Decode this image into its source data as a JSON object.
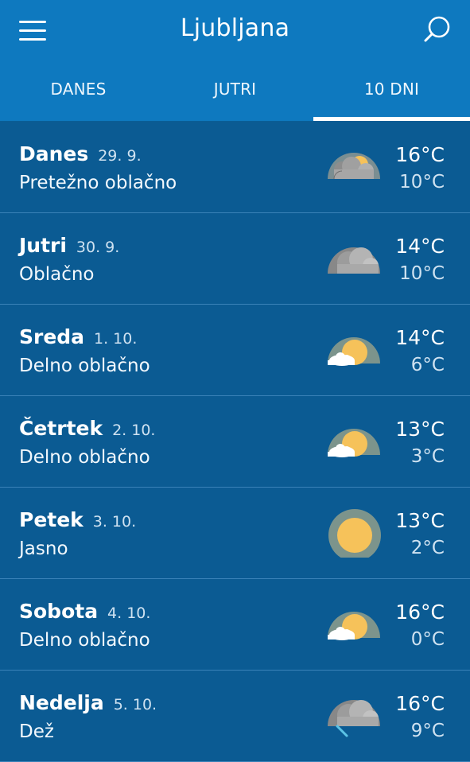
{
  "header": {
    "title": "Ljubljana",
    "menu_icon": "hamburger-menu-icon",
    "search_icon": "search-icon"
  },
  "tabs": [
    {
      "label": "DANES",
      "active": false
    },
    {
      "label": "JUTRI",
      "active": false
    },
    {
      "label": "10 DNI",
      "active": true
    }
  ],
  "days": [
    {
      "name": "Danes",
      "date": "29. 9.",
      "condition": "Pretežno oblačno",
      "high": "16°C",
      "low": "10°C",
      "icon": "mostly-cloudy-icon"
    },
    {
      "name": "Jutri",
      "date": "30. 9.",
      "condition": "Oblačno",
      "high": "14°C",
      "low": "10°C",
      "icon": "cloudy-icon"
    },
    {
      "name": "Sreda",
      "date": "1. 10.",
      "condition": "Delno oblačno",
      "high": "14°C",
      "low": "6°C",
      "icon": "partly-cloudy-icon"
    },
    {
      "name": "Četrtek",
      "date": "2. 10.",
      "condition": "Delno oblačno",
      "high": "13°C",
      "low": "3°C",
      "icon": "partly-cloudy-icon"
    },
    {
      "name": "Petek",
      "date": "3. 10.",
      "condition": "Jasno",
      "high": "13°C",
      "low": "2°C",
      "icon": "sunny-icon"
    },
    {
      "name": "Sobota",
      "date": "4. 10.",
      "condition": "Delno oblačno",
      "high": "16°C",
      "low": "0°C",
      "icon": "partly-cloudy-icon"
    },
    {
      "name": "Nedelja",
      "date": "5. 10.",
      "condition": "Dež",
      "high": "16°C",
      "low": "9°C",
      "icon": "rain-icon"
    }
  ],
  "colors": {
    "header_bg": "#0e79bf",
    "list_bg": "#0b5b93",
    "divider": "#3a82b8",
    "sun": "#f6c25a",
    "cloud": "#9a9a9a"
  }
}
